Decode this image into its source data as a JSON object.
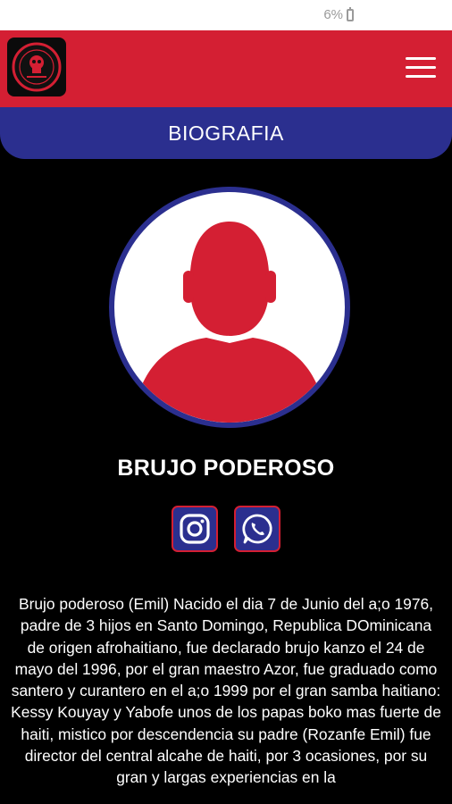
{
  "status_bar": {
    "battery_text": "6%"
  },
  "header": {
    "title": "BIOGRAFIA"
  },
  "colors": {
    "primary_red": "#d41f33",
    "primary_blue": "#2b2f8f",
    "background": "#000000"
  },
  "profile": {
    "name": "BRUJO PODEROSO",
    "avatar_icon": "person-silhouette-icon"
  },
  "social": [
    {
      "name": "instagram",
      "icon": "instagram-icon"
    },
    {
      "name": "whatsapp",
      "icon": "whatsapp-icon"
    }
  ],
  "bio": {
    "text": "Brujo poderoso (Emil) Nacido el dia 7 de Junio del a;o 1976, padre de 3 hijos en Santo Domingo, Republica DOminicana de origen afrohaitiano, fue declarado brujo kanzo el 24 de mayo del 1996, por el gran maestro Azor, fue graduado como santero y curantero en el a;o 1999 por el gran samba haitiano: Kessy Kouyay y Yabofe unos de los papas boko mas fuerte de haiti, mistico por descendencia su padre (Rozanfe Emil) fue director del central alcahe de haiti, por 3 ocasiones, por su gran y largas experiencias en la"
  }
}
